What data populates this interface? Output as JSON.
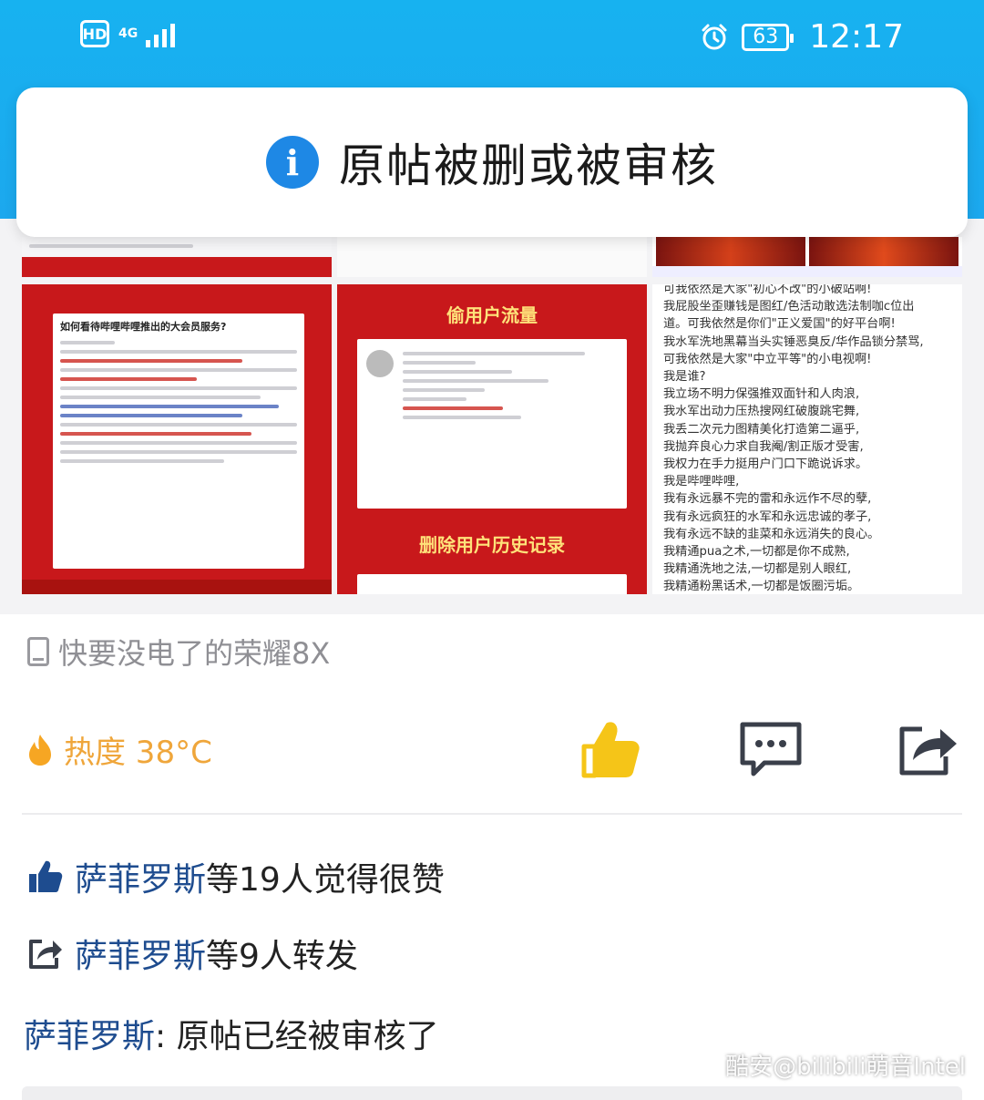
{
  "status_bar": {
    "hd": "HD",
    "network": "4G",
    "battery": "63",
    "time": "12:17",
    "alarm_icon": "alarm-clock-icon"
  },
  "toast": {
    "icon": "info-icon",
    "message": "原帖被删或被审核"
  },
  "images": {
    "tile1_title": "如何看待哔哩哔哩推出的大会员服务?",
    "tile2_heading_top": "偷用户流量",
    "tile2_heading_bottom": "删除用户历史记录",
    "tile3_lines": [
      "可我依然是大家\"初心不改\"的小破站啊!",
      "我屁股坐歪赚钱是图红/色活动敢选法制咖c位出",
      "道。可我依然是你们\"正义爱国\"的好平台啊!",
      "我水军洗地黑幕当头实锤恶臭反/华作品锁分禁骂,",
      "可我依然是大家\"中立平等\"的小电视啊!",
      "我是谁?",
      "我立场不明力保强推双面针和人肉浪,",
      "我水军出动力压热搜网红破腹跳宅舞,",
      "我丢二次元力图精美化打造第二逼乎,",
      "我抛弃良心力求自我阉/割正版才受害,",
      "我权力在手力挺用户门口下跪说诉求。",
      "我是哔哩哔哩,",
      "我有永远暴不完的雷和永远作不尽的孽,",
      "我有永远疯狂的水军和永远忠诚的孝子,",
      "我有永远不缺的韭菜和永远消失的良心。",
      "我精通pua之术,一切都是你不成熟,",
      "我精通洗地之法,一切都是别人眼红,",
      "我精通粉黑话术,一切都是饭圈污垢。"
    ]
  },
  "device": {
    "icon": "phone-icon",
    "label": "快要没电了的荣耀8X"
  },
  "actions": {
    "heat_icon": "flame-icon",
    "heat_label": "热度 38°C",
    "like_icon": "thumbs-up-icon",
    "comment_icon": "comment-icon",
    "share_icon": "share-icon",
    "like_color": "#f5c518"
  },
  "social": {
    "likes_name": "萨菲罗斯",
    "likes_text": "等19人觉得很赞",
    "shares_name": "萨菲罗斯",
    "shares_text": "等9人转发",
    "comment_name": "萨菲罗斯",
    "comment_text": ": 原帖已经被审核了"
  },
  "watermark": "酷安@bilibili萌音Intel"
}
